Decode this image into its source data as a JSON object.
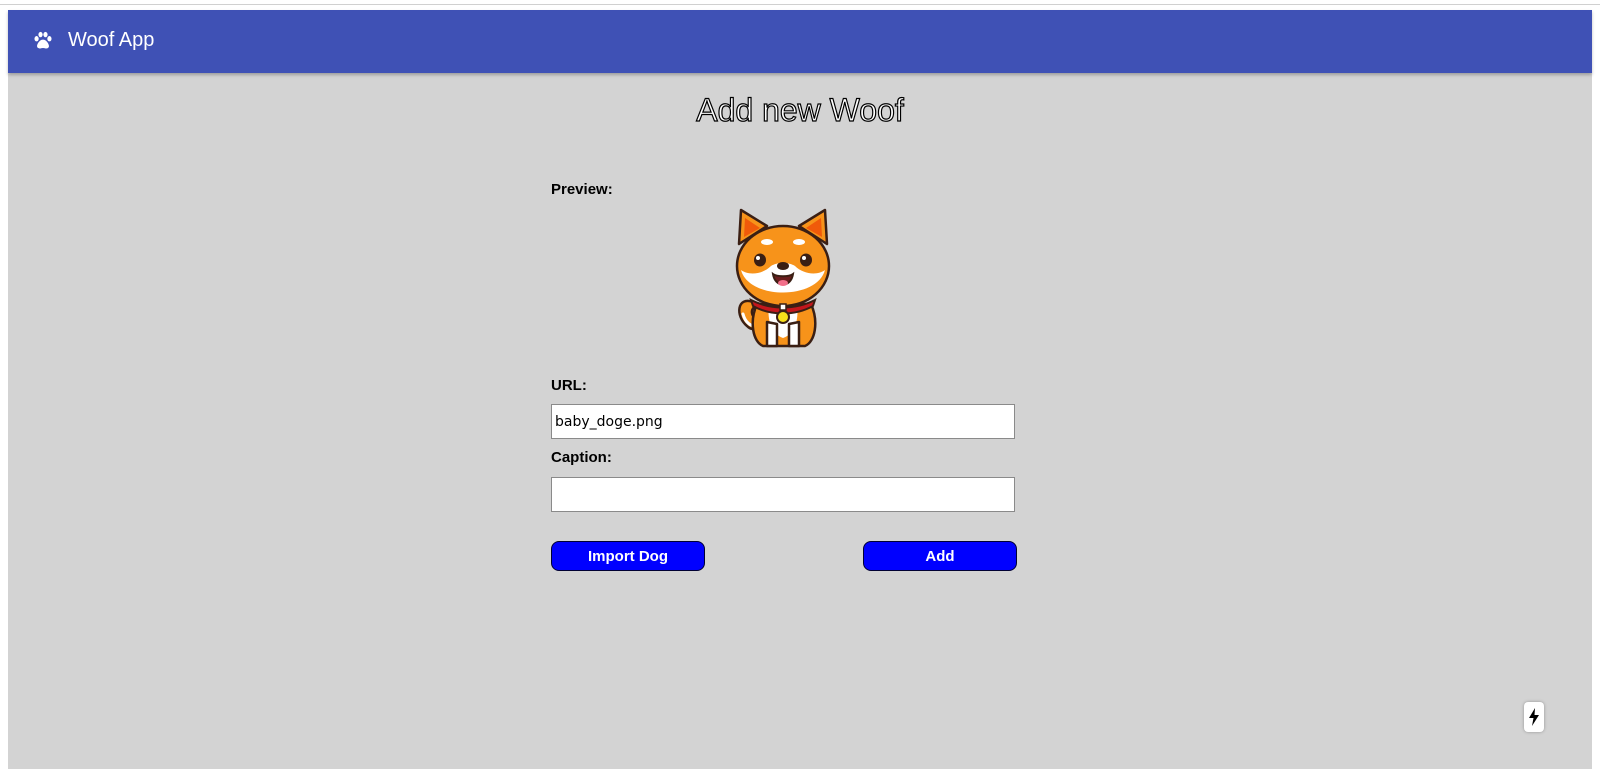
{
  "header": {
    "app_title": "Woof App",
    "icon": "paw-icon",
    "bar_color": "#3f51b5"
  },
  "main": {
    "title": "Add new Woof",
    "preview_label": "Preview:",
    "preview_image": "shiba-dog-cartoon",
    "url_label": "URL:",
    "url_value": "baby_doge.png",
    "caption_label": "Caption:",
    "caption_value": "",
    "import_button_label": "Import Dog",
    "add_button_label": "Add",
    "button_color": "#0000ff",
    "background_color": "#d3d3d3"
  },
  "corner_badge": {
    "icon": "lightning-bolt-icon"
  }
}
